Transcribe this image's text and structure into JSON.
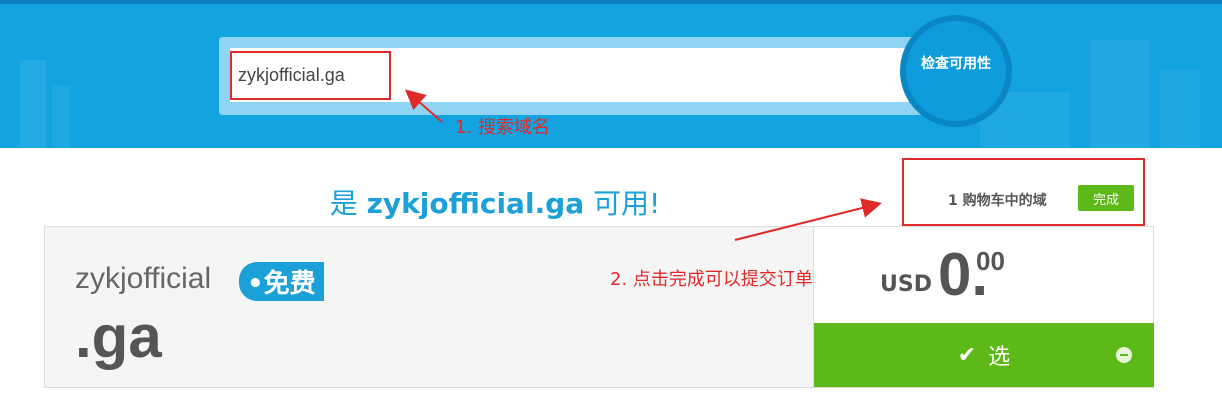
{
  "search": {
    "value": "zykjofficial.ga",
    "button_label": "检查可用性"
  },
  "annotations": {
    "step1": "1. 搜索域名",
    "step2": "2. 点击完成可以提交订单"
  },
  "availability": {
    "prefix": "是 ",
    "domain": "zykjofficial.ga",
    "suffix": " 可用!"
  },
  "cart": {
    "summary": "1 购物车中的域",
    "done_label": "完成"
  },
  "result": {
    "name": "zykjofficial",
    "badge": "•免费",
    "tld": ".ga"
  },
  "price": {
    "currency": "USD",
    "integer": "0.",
    "decimal": "00"
  },
  "select": {
    "label": "选"
  },
  "colors": {
    "brand_blue": "#12a3e0",
    "success_green": "#5cb917",
    "annotation_red": "#e02a2a"
  }
}
